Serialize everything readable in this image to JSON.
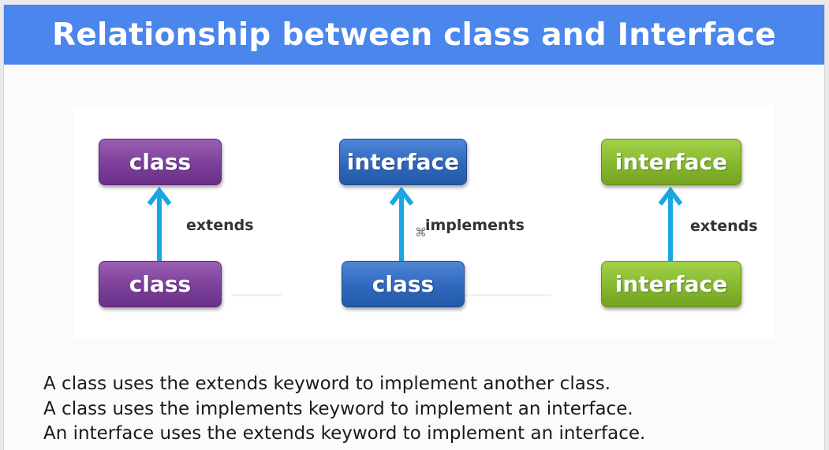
{
  "title": "Relationship between class and Interface",
  "diagrams": [
    {
      "top_box": "class",
      "bottom_box": "class",
      "relation": "extends",
      "color": "#7c3f9a"
    },
    {
      "top_box": "interface",
      "bottom_box": "class",
      "relation": "implements",
      "color": "#2f67bd"
    },
    {
      "top_box": "interface",
      "bottom_box": "interface",
      "relation": "extends",
      "color": "#86b82d"
    }
  ],
  "arrow_color": "#19a6e2",
  "descriptions": [
    "A class uses the extends keyword to implement another class.",
    "A class uses the implements keyword to implement an interface.",
    "An interface uses the extends keyword to implement an interface."
  ]
}
